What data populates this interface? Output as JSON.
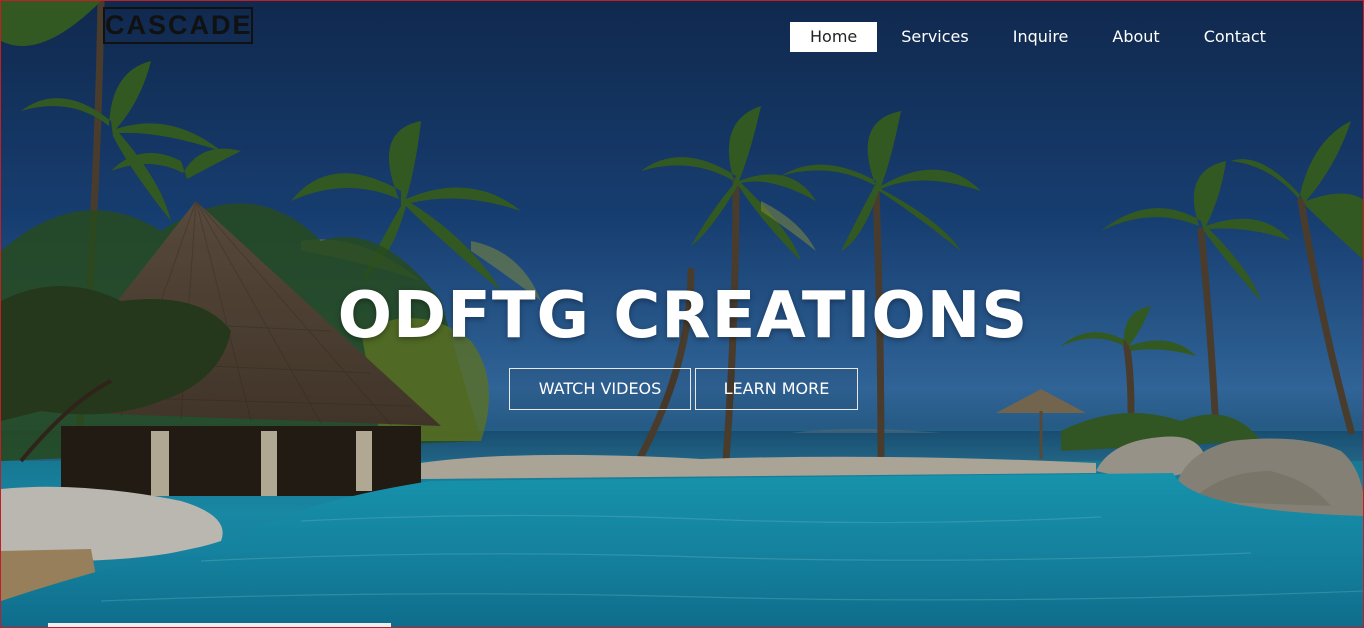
{
  "brand": {
    "logo_text": "CASCADE"
  },
  "nav": {
    "items": [
      {
        "label": "Home",
        "active": true
      },
      {
        "label": "Services",
        "active": false
      },
      {
        "label": "Inquire",
        "active": false
      },
      {
        "label": "About",
        "active": false
      },
      {
        "label": "Contact",
        "active": false
      }
    ]
  },
  "hero": {
    "title": "ODFTG CREATIONS",
    "buttons": {
      "watch": "WATCH VIDEOS",
      "learn": "LEARN MORE"
    },
    "background": "tropical-resort-pool-palms"
  },
  "colors": {
    "border": "#c21e25",
    "water": "#1fa6c7",
    "sky": "#1d4c8a"
  }
}
